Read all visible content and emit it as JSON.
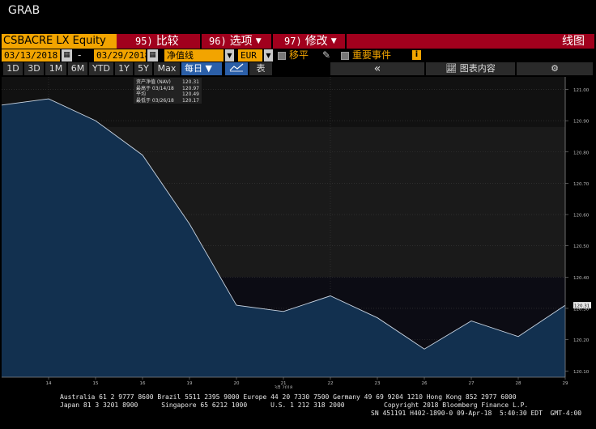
{
  "window": {
    "title": "GRAB"
  },
  "toolbar1": {
    "ticker": "CSBACRE LX Equity",
    "menus": [
      {
        "num": "95)",
        "label": "比较",
        "caret": false
      },
      {
        "num": "96)",
        "label": "选项",
        "caret": true
      },
      {
        "num": "97)",
        "label": "修改",
        "caret": true
      }
    ],
    "right_label": "线图"
  },
  "toolbar2": {
    "start_date": "03/13/2018",
    "end_date": "03/29/2018",
    "dash": "-",
    "series_select": "净值线",
    "currency": "EUR",
    "moving_label": "移平",
    "events_label": "重要事件",
    "info": "i"
  },
  "toolbar3": {
    "ranges": [
      "1D",
      "3D",
      "1M",
      "6M",
      "YTD",
      "1Y",
      "5Y",
      "Max"
    ],
    "frequency": "每日",
    "table_label": "表",
    "collapse": "«",
    "chart_content_label": "图表内容",
    "settings": "⚙"
  },
  "legend": {
    "rows": [
      {
        "label": "资产净值 (NAV)",
        "value": "120.31"
      },
      {
        "label": "最高于 03/14/18",
        "value": "120.97"
      },
      {
        "label": "平均",
        "value": "120.49"
      },
      {
        "label": "最低于 03/26/18",
        "value": "120.17"
      }
    ]
  },
  "chart_data": {
    "type": "area",
    "x": [
      "13",
      "14",
      "15",
      "16",
      "19",
      "20",
      "21",
      "22",
      "23",
      "26",
      "27",
      "28",
      "29"
    ],
    "series": [
      {
        "values": [
          120.95,
          120.97,
          120.9,
          120.79,
          120.57,
          120.31,
          120.29,
          120.34,
          120.27,
          120.17,
          120.26,
          120.21,
          120.31
        ]
      }
    ],
    "x_tick_labels": [
      "14",
      "15",
      "16",
      "19",
      "20",
      "21",
      "22",
      "23",
      "26",
      "27",
      "28",
      "29"
    ],
    "x_sublabel": "3月 2018",
    "y_tick_labels": [
      "121.00",
      "120.90",
      "120.80",
      "120.70",
      "120.60",
      "120.50",
      "120.40",
      "120.30",
      "120.20",
      "120.10"
    ],
    "ylim": [
      120.08,
      121.04
    ],
    "last_value_label": "120.31",
    "colors": {
      "fill": "#12304f",
      "line": "#c8d4e2",
      "bg": "#1a1a1a",
      "grid": "#3a3a3a",
      "marker": "#f2a400"
    }
  },
  "footer": {
    "line1": "Australia 61 2 9777 8600 Brazil 5511 2395 9000 Europe 44 20 7330 7500 Germany 49 69 9204 1210 Hong Kong 852 2977 6000",
    "line2_left": "Japan 81 3 3201 8900      Singapore 65 6212 1000      U.S. 1 212 318 2000",
    "line2_right": "Copyright 2018 Bloomberg Finance L.P.",
    "line3": "SN 451191 H402-1890-0 09-Apr-18  5:40:30 EDT  GMT-4:00"
  }
}
